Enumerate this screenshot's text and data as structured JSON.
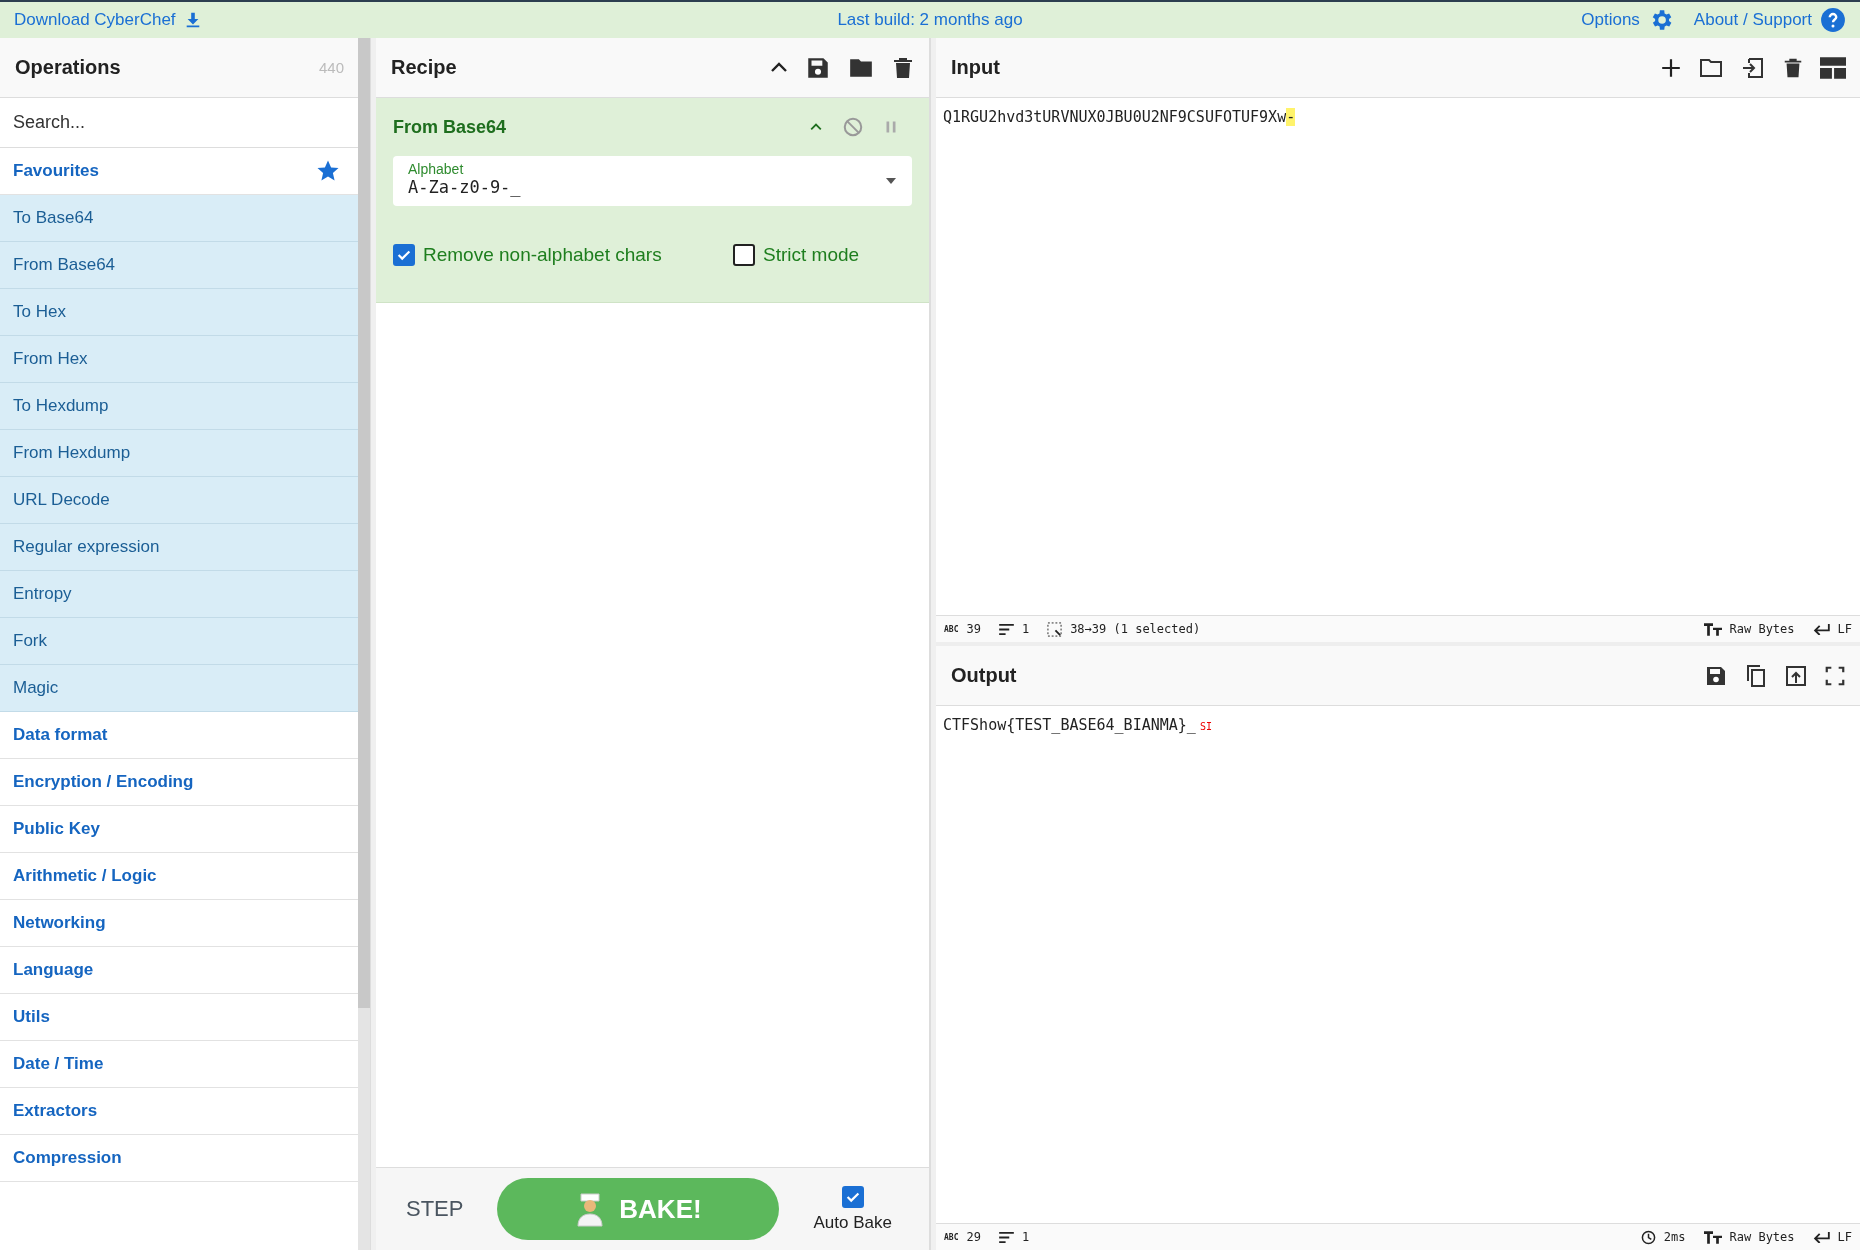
{
  "top_bar": {
    "download": "Download CyberChef",
    "build": "Last build: 2 months ago",
    "options": "Options",
    "about": "About / Support"
  },
  "operations": {
    "title": "Operations",
    "count": "440",
    "search": {
      "placeholder": "Search..."
    },
    "favourites": {
      "label": "Favourites",
      "items": [
        "To Base64",
        "From Base64",
        "To Hex",
        "From Hex",
        "To Hexdump",
        "From Hexdump",
        "URL Decode",
        "Regular expression",
        "Entropy",
        "Fork",
        "Magic"
      ]
    },
    "categories": [
      "Data format",
      "Encryption / Encoding",
      "Public Key",
      "Arithmetic / Logic",
      "Networking",
      "Language",
      "Utils",
      "Date / Time",
      "Extractors",
      "Compression"
    ]
  },
  "recipe": {
    "title": "Recipe",
    "operations": [
      {
        "name": "From Base64",
        "args": [
          {
            "kind": "dropdown",
            "label": "Alphabet",
            "value": "A-Za-z0-9-_"
          },
          {
            "kind": "checkbox",
            "label": "Remove non-alphabet chars",
            "checked": true
          },
          {
            "kind": "checkbox",
            "label": "Strict mode",
            "checked": false
          }
        ]
      }
    ]
  },
  "controls": {
    "step": "STEP",
    "bake": "BAKE!",
    "auto_bake": {
      "label": "Auto Bake",
      "checked": true
    }
  },
  "input": {
    "title": "Input",
    "text": "Q1RGU2hvd3tURVNUX0JBU0U2NF9CSUFOTUF9Xw",
    "selected_text": "-",
    "status": {
      "chars_label": "ABC",
      "chars": "39",
      "lines": "1",
      "selection": "38→39 (1 selected)",
      "encoding": "Raw Bytes",
      "eol": "LF"
    }
  },
  "output": {
    "title": "Output",
    "text": "CTFShow{TEST_BASE64_BIANMA}_",
    "control_char": "SI",
    "status": {
      "chars_label": "ABC",
      "chars": "29",
      "lines": "1",
      "time": "2ms",
      "encoding": "Raw Bytes",
      "eol": "LF"
    }
  }
}
